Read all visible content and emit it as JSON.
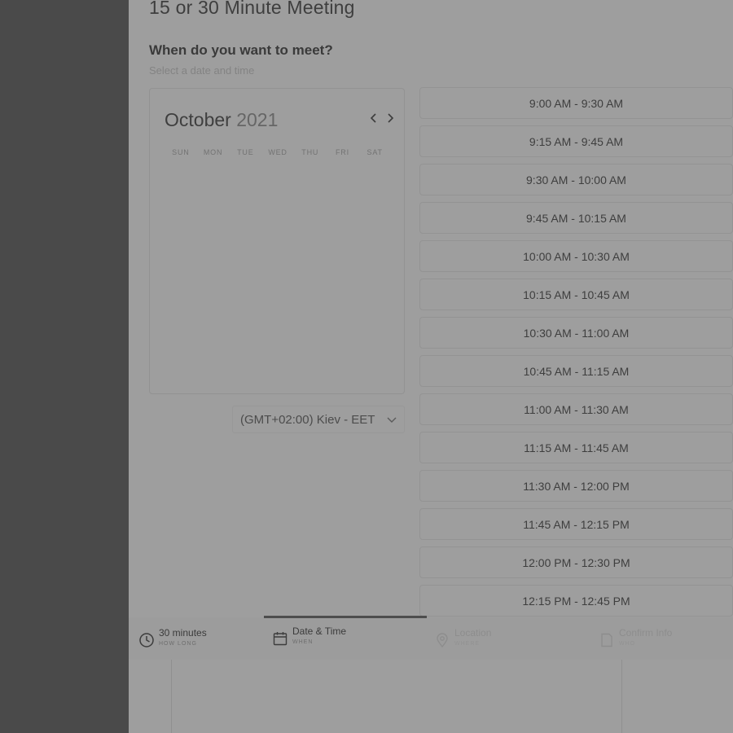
{
  "header": {
    "title": "15 or 30 Minute Meeting"
  },
  "prompt": {
    "question": "When do you want to meet?",
    "hint": "Select a date and time"
  },
  "calendar": {
    "month": "October",
    "year": "2021",
    "prev_icon": "chevron-left-icon",
    "next_icon": "chevron-right-icon",
    "weekdays": [
      "SUN",
      "MON",
      "TUE",
      "WED",
      "THU",
      "FRI",
      "SAT"
    ]
  },
  "timezone": {
    "label": "(GMT+02:00) Kiev - EET",
    "icon": "chevron-down-icon"
  },
  "time_slots": [
    "9:00 AM - 9:30 AM",
    "9:15 AM - 9:45 AM",
    "9:30 AM - 10:00 AM",
    "9:45 AM - 10:15 AM",
    "10:00 AM - 10:30 AM",
    "10:15 AM - 10:45 AM",
    "10:30 AM - 11:00 AM",
    "10:45 AM - 11:15 AM",
    "11:00 AM - 11:30 AM",
    "11:15 AM - 11:45 AM",
    "11:30 AM - 12:00 PM",
    "11:45 AM - 12:15 PM",
    "12:00 PM - 12:30 PM",
    "12:15 PM - 12:45 PM"
  ],
  "steps": [
    {
      "title": "30 minutes",
      "subtitle": "HOW LONG",
      "icon": "clock-icon"
    },
    {
      "title": "Date & Time",
      "subtitle": "WHEN",
      "icon": "calendar-icon"
    },
    {
      "title": "Location",
      "subtitle": "WHERE",
      "icon": "location-pin-icon"
    },
    {
      "title": "Confirm Info",
      "subtitle": "WHO",
      "icon": "document-icon"
    }
  ],
  "colors": {
    "overlay": "#9e9e9e",
    "left_rail": "#4a4a4a",
    "progress": "#4d4d4d"
  }
}
